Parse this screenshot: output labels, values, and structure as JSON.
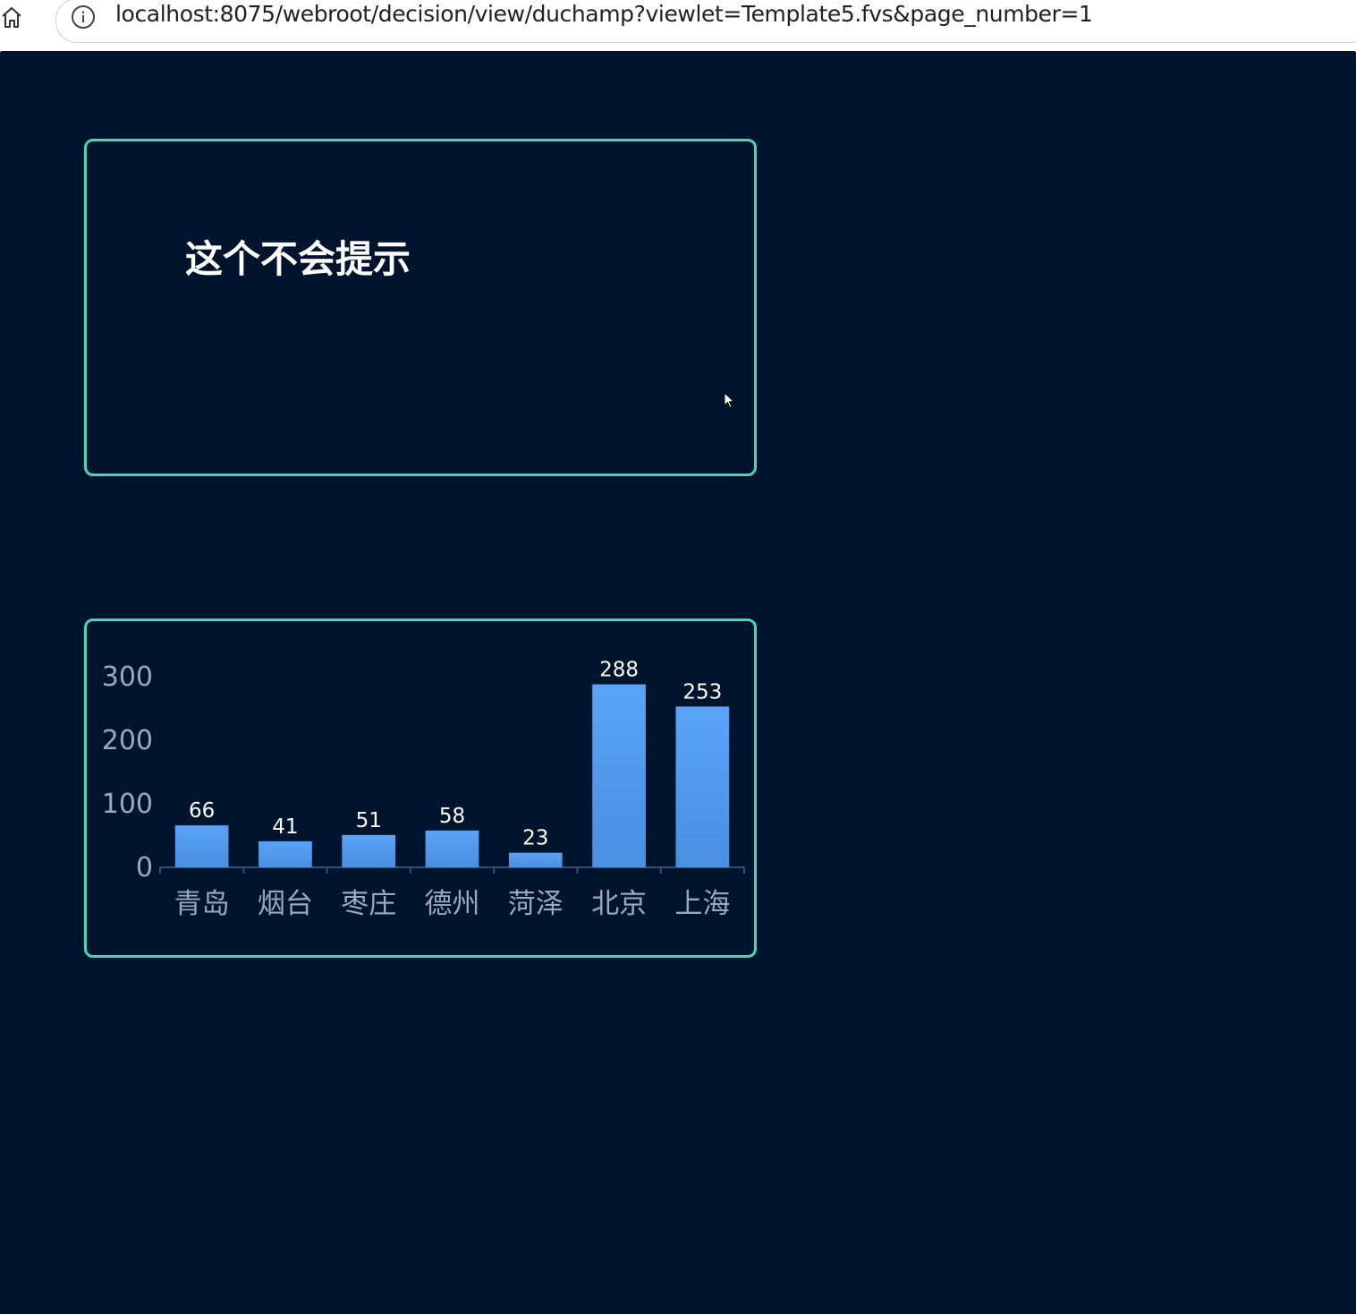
{
  "browser": {
    "url": "localhost:8075/webroot/decision/view/duchamp?viewlet=Template5.fvs&page_number=1",
    "icons": [
      "home-icon",
      "info-icon"
    ]
  },
  "dashboard": {
    "tip_text": "这个不会提示",
    "colors": {
      "background": "#00142e",
      "panel_border": "#46d7bb",
      "bar": "#4f95e8",
      "bar_top": "#5aa3f7",
      "axis_text": "#9aa7c0"
    }
  },
  "chart_data": {
    "type": "bar",
    "categories": [
      "青岛",
      "烟台",
      "枣庄",
      "德州",
      "菏泽",
      "北京",
      "上海"
    ],
    "values": [
      66,
      41,
      51,
      58,
      23,
      288,
      253
    ],
    "data_labels": [
      "66",
      "41",
      "51",
      "58",
      "23",
      "288",
      "253"
    ],
    "yticks": [
      "0",
      "100",
      "200",
      "300"
    ],
    "ytick_values": [
      0,
      100,
      200,
      300
    ],
    "ylim": [
      0,
      300
    ],
    "grid": false,
    "legend": "none"
  }
}
